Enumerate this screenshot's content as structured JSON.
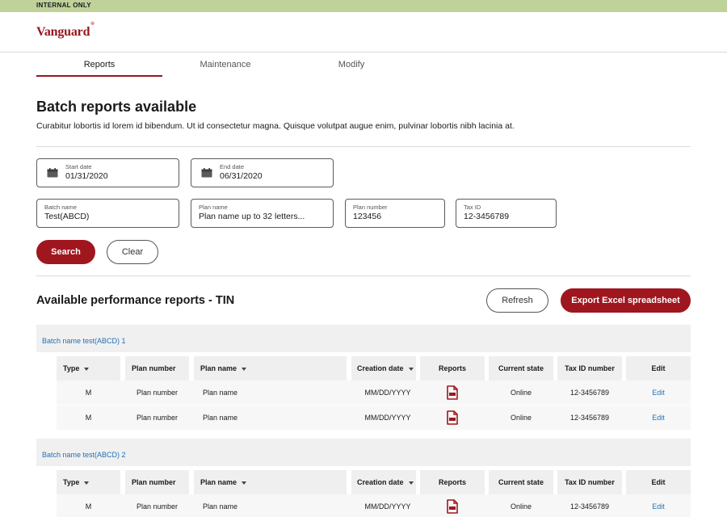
{
  "banner": {
    "text": "INTERNAL ONLY"
  },
  "header": {
    "logo": "Vanguard",
    "logo_mark": "®"
  },
  "tabs": [
    {
      "label": "Reports",
      "active": true
    },
    {
      "label": "Maintenance",
      "active": false
    },
    {
      "label": "Modify",
      "active": false
    }
  ],
  "page": {
    "title": "Batch reports available",
    "description": "Curabitur lobortis id lorem id bibendum. Ut id consectetur magna. Quisque volutpat augue enim, pulvinar lobortis nibh lacinia at."
  },
  "filters": {
    "start_date": {
      "label": "Start date",
      "value": "01/31/2020",
      "icon": "calendar-icon"
    },
    "end_date": {
      "label": "End date",
      "value": "06/31/2020",
      "icon": "calendar-icon"
    },
    "batch_name": {
      "label": "Batch name",
      "value": "Test(ABCD)"
    },
    "plan_name": {
      "label": "Plan name",
      "value": "Plan name up to 32 letters..."
    },
    "plan_number": {
      "label": "Plan number",
      "value": "123456"
    },
    "tax_id": {
      "label": "Tax ID",
      "value": "12-3456789"
    }
  },
  "actions": {
    "search": "Search",
    "clear": "Clear",
    "refresh": "Refresh",
    "export": "Export Excel spreadsheet"
  },
  "section": {
    "title": "Available performance reports - TIN"
  },
  "columns": [
    "Type",
    "Plan number",
    "Plan name",
    "Creation date",
    "Reports",
    "Current state",
    "Tax ID number",
    "Edit"
  ],
  "batches": [
    {
      "name": "Batch name test(ABCD) 1",
      "rows": [
        {
          "type": "M",
          "plan_number": "Plan number",
          "plan_name": "Plan name",
          "creation_date": "MM/DD/YYYY",
          "report_icon": "pdf-icon",
          "state": "Online",
          "tax_id": "12-3456789",
          "edit": "Edit"
        },
        {
          "type": "M",
          "plan_number": "Plan number",
          "plan_name": "Plan name",
          "creation_date": "MM/DD/YYYY",
          "report_icon": "pdf-icon",
          "state": "Online",
          "tax_id": "12-3456789",
          "edit": "Edit"
        }
      ]
    },
    {
      "name": "Batch name test(ABCD) 2",
      "rows": [
        {
          "type": "M",
          "plan_number": "Plan number",
          "plan_name": "Plan name",
          "creation_date": "MM/DD/YYYY",
          "report_icon": "pdf-icon",
          "state": "Online",
          "tax_id": "12-3456789",
          "edit": "Edit"
        }
      ]
    }
  ],
  "colors": {
    "brand": "#96151d",
    "button": "#a0161f",
    "link": "#2272b6",
    "banner": "#bfd29a"
  }
}
